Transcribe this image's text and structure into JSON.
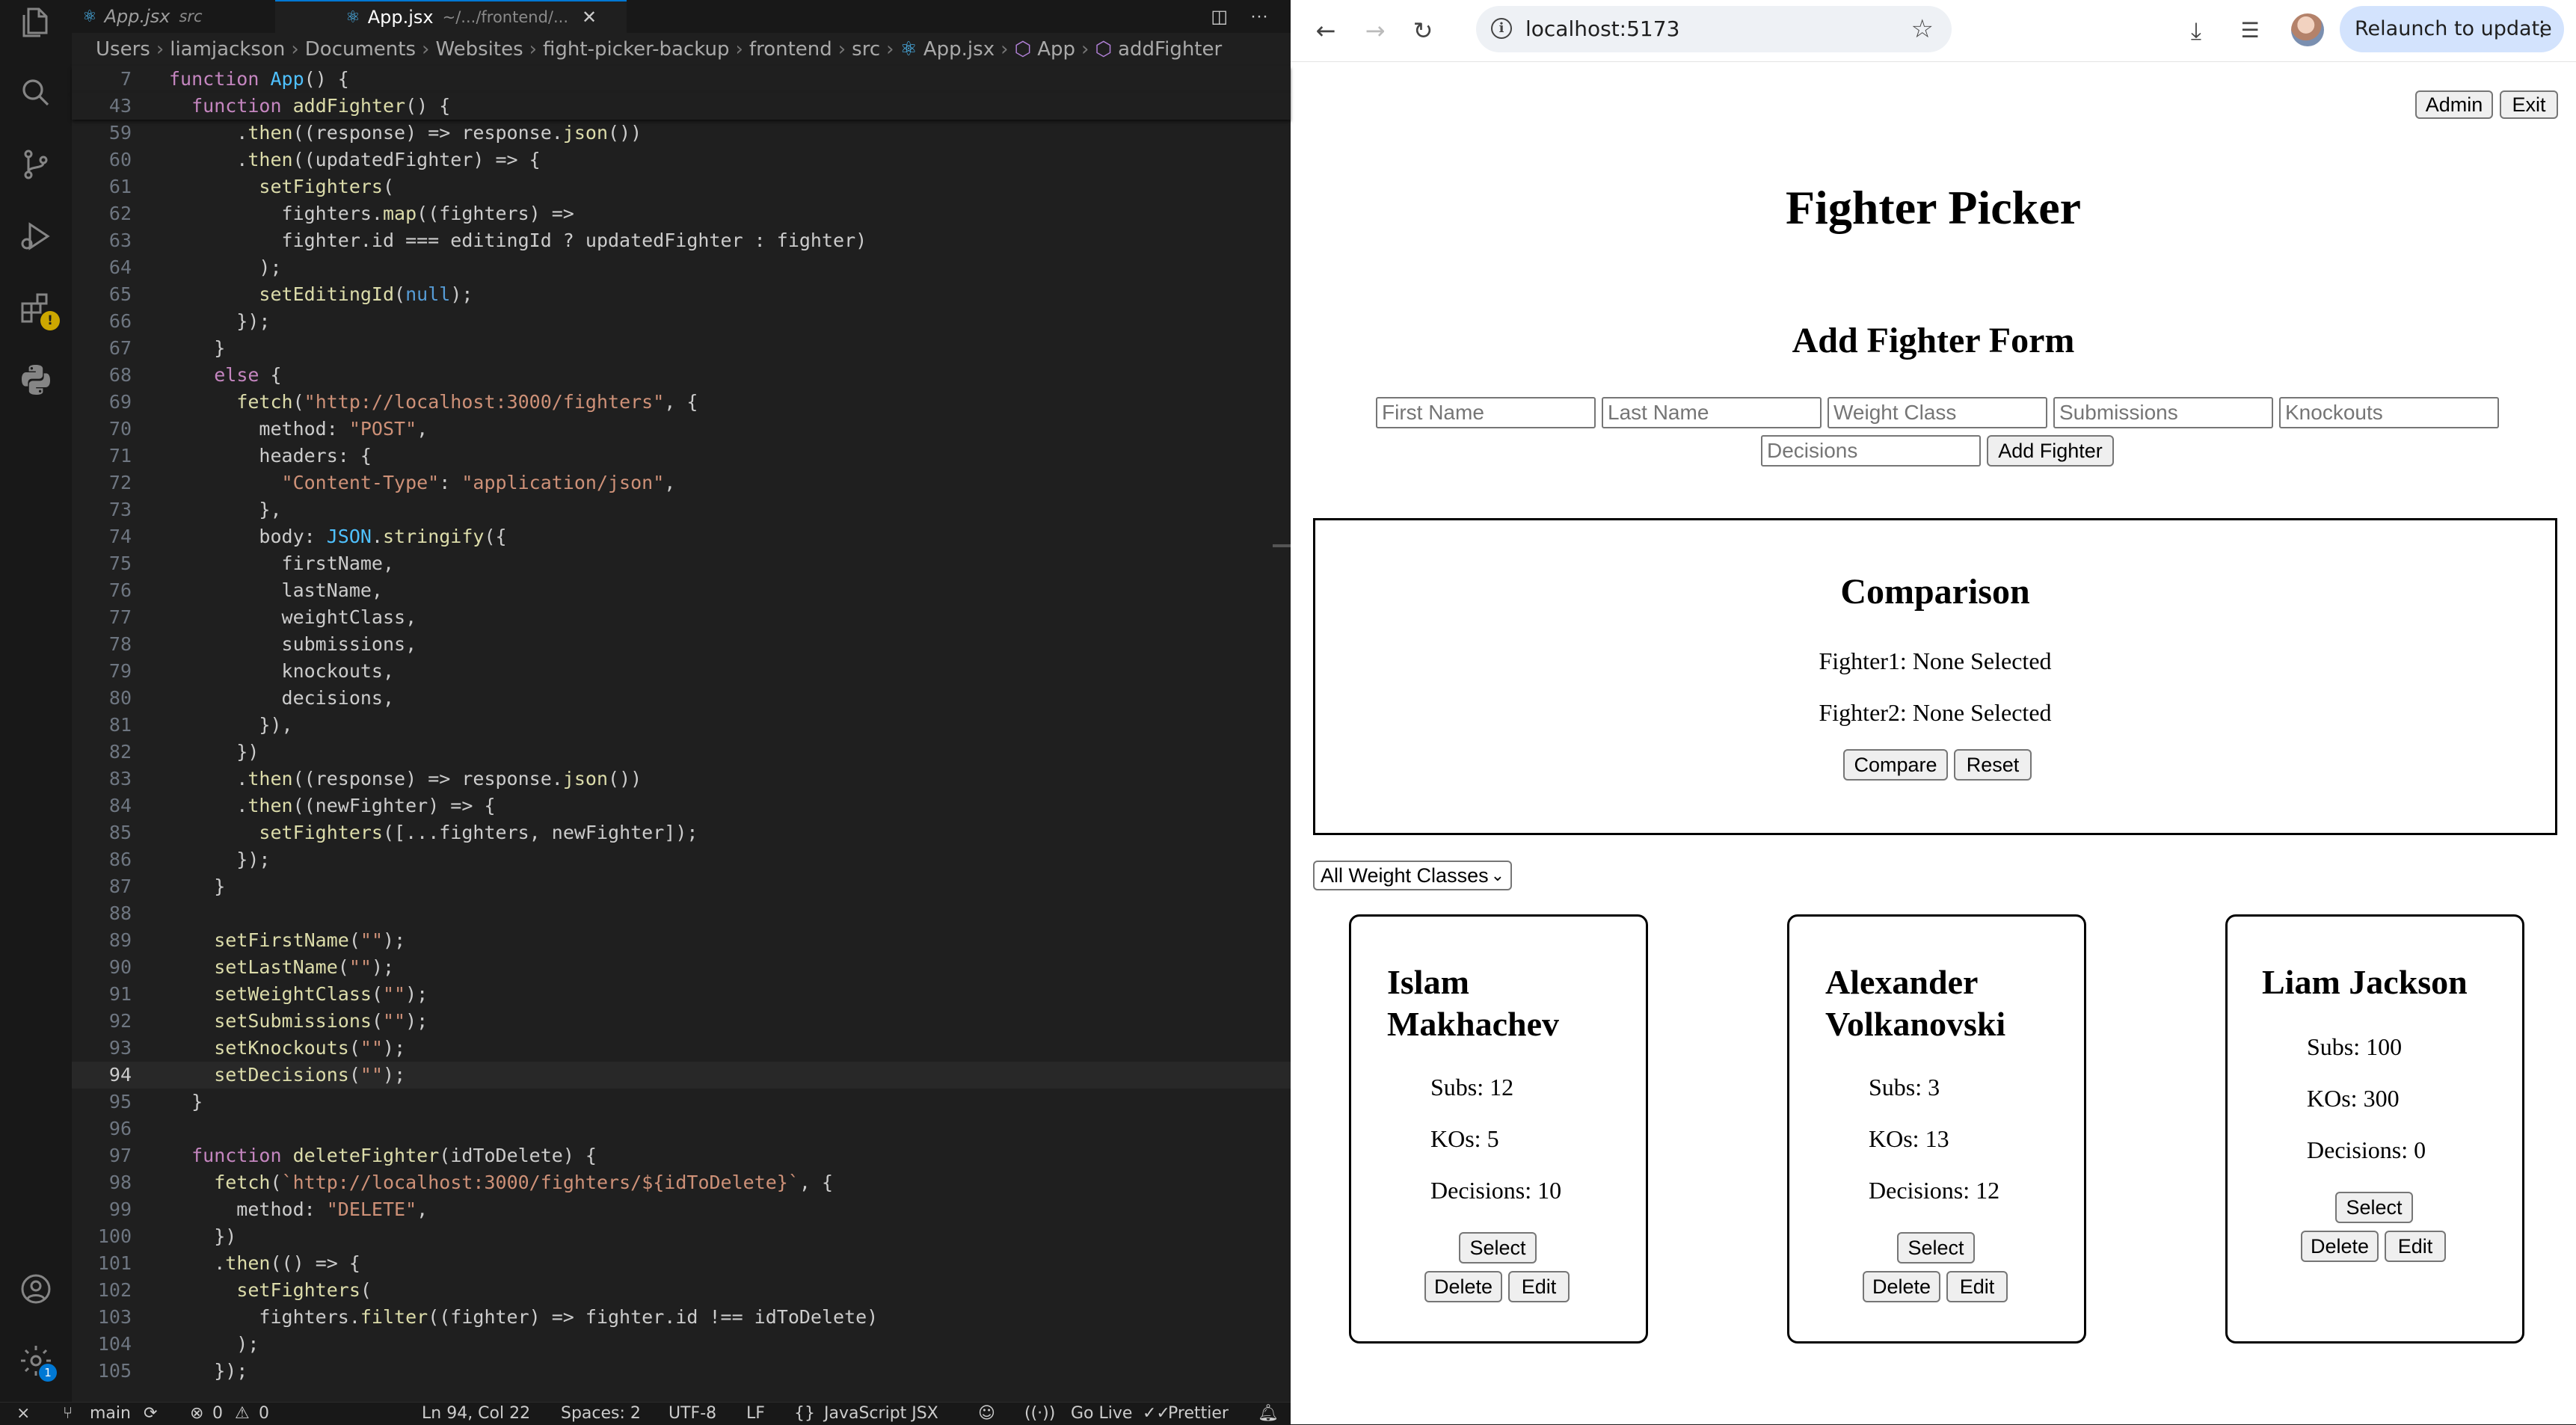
{
  "vscode": {
    "tabs": [
      {
        "name": "App.jsx",
        "desc": "src",
        "active": false
      },
      {
        "name": "App.jsx",
        "desc": "~/.../frontend/...",
        "active": true
      }
    ],
    "breadcrumbs": [
      "Users",
      "liamjackson",
      "Documents",
      "Websites",
      "fight-picker-backup",
      "frontend",
      "src",
      "App.jsx",
      "App",
      "addFighter"
    ],
    "status": {
      "branch": "main",
      "problems": "0",
      "warnings": "0",
      "cursor": "Ln 94, Col 22",
      "spaces": "Spaces: 2",
      "encoding": "UTF-8",
      "eol": "LF",
      "language": "JavaScript JSX",
      "golive": "Go Live",
      "prettier": "Prettier"
    },
    "settings_badge": "1"
  },
  "code_lines": [
    {
      "n": "7",
      "t": "function App() {"
    },
    {
      "n": "43",
      "t": "  function addFighter() {"
    },
    {
      "n": "59",
      "t": "      .then((response) => response.json())"
    },
    {
      "n": "60",
      "t": "      .then((updatedFighter) => {"
    },
    {
      "n": "61",
      "t": "        setFighters("
    },
    {
      "n": "62",
      "t": "          fighters.map((fighters) =>"
    },
    {
      "n": "63",
      "t": "          fighter.id === editingId ? updatedFighter : fighter)"
    },
    {
      "n": "64",
      "t": "        );"
    },
    {
      "n": "65",
      "t": "        setEditingId(null);"
    },
    {
      "n": "66",
      "t": "      });"
    },
    {
      "n": "67",
      "t": "    }"
    },
    {
      "n": "68",
      "t": "    else {"
    },
    {
      "n": "69",
      "t": "      fetch(\"http://localhost:3000/fighters\", {"
    },
    {
      "n": "70",
      "t": "        method: \"POST\","
    },
    {
      "n": "71",
      "t": "        headers: {"
    },
    {
      "n": "72",
      "t": "          \"Content-Type\": \"application/json\","
    },
    {
      "n": "73",
      "t": "        },"
    },
    {
      "n": "74",
      "t": "        body: JSON.stringify({"
    },
    {
      "n": "75",
      "t": "          firstName,"
    },
    {
      "n": "76",
      "t": "          lastName,"
    },
    {
      "n": "77",
      "t": "          weightClass,"
    },
    {
      "n": "78",
      "t": "          submissions,"
    },
    {
      "n": "79",
      "t": "          knockouts,"
    },
    {
      "n": "80",
      "t": "          decisions,"
    },
    {
      "n": "81",
      "t": "        }),"
    },
    {
      "n": "82",
      "t": "      })"
    },
    {
      "n": "83",
      "t": "      .then((response) => response.json())"
    },
    {
      "n": "84",
      "t": "      .then((newFighter) => {"
    },
    {
      "n": "85",
      "t": "        setFighters([...fighters, newFighter]);"
    },
    {
      "n": "86",
      "t": "      });"
    },
    {
      "n": "87",
      "t": "    }"
    },
    {
      "n": "88",
      "t": ""
    },
    {
      "n": "89",
      "t": "    setFirstName(\"\");"
    },
    {
      "n": "90",
      "t": "    setLastName(\"\");"
    },
    {
      "n": "91",
      "t": "    setWeightClass(\"\");"
    },
    {
      "n": "92",
      "t": "    setSubmissions(\"\");"
    },
    {
      "n": "93",
      "t": "    setKnockouts(\"\");"
    },
    {
      "n": "94",
      "t": "    setDecisions(\"\");"
    },
    {
      "n": "95",
      "t": "  }"
    },
    {
      "n": "96",
      "t": ""
    },
    {
      "n": "97",
      "t": "  function deleteFighter(idToDelete) {"
    },
    {
      "n": "98",
      "t": "    fetch(`http://localhost:3000/fighters/${idToDelete}`, {"
    },
    {
      "n": "99",
      "t": "      method: \"DELETE\","
    },
    {
      "n": "100",
      "t": "    })"
    },
    {
      "n": "101",
      "t": "    .then(() => {"
    },
    {
      "n": "102",
      "t": "      setFighters("
    },
    {
      "n": "103",
      "t": "        fighters.filter((fighter) => fighter.id !== idToDelete)"
    },
    {
      "n": "104",
      "t": "      );"
    },
    {
      "n": "105",
      "t": "    });"
    }
  ],
  "browser": {
    "url": "localhost:5173",
    "relaunch_label": "Relaunch to update"
  },
  "app": {
    "admin_label": "Admin",
    "exit_label": "Exit",
    "title": "Fighter Picker",
    "form_title": "Add Fighter Form",
    "placeholders": {
      "first": "First Name",
      "last": "Last Name",
      "weight": "Weight Class",
      "subs": "Submissions",
      "kos": "Knockouts",
      "decisions": "Decisions"
    },
    "add_label": "Add Fighter",
    "comparison": {
      "title": "Comparison",
      "fighter1": "Fighter1: None Selected",
      "fighter2": "Fighter2: None Selected",
      "compare_label": "Compare",
      "reset_label": "Reset"
    },
    "filter_value": "All Weight Classes",
    "fighters": [
      {
        "name": "Islam Makhachev",
        "subs": "Subs: 12",
        "kos": "KOs: 5",
        "decisions": "Decisions: 10"
      },
      {
        "name": "Alexander Volkanovski",
        "subs": "Subs: 3",
        "kos": "KOs: 13",
        "decisions": "Decisions: 12"
      },
      {
        "name": "Liam Jackson",
        "subs": "Subs: 100",
        "kos": "KOs: 300",
        "decisions": "Decisions: 0"
      }
    ],
    "select_label": "Select",
    "delete_label": "Delete",
    "edit_label": "Edit"
  }
}
